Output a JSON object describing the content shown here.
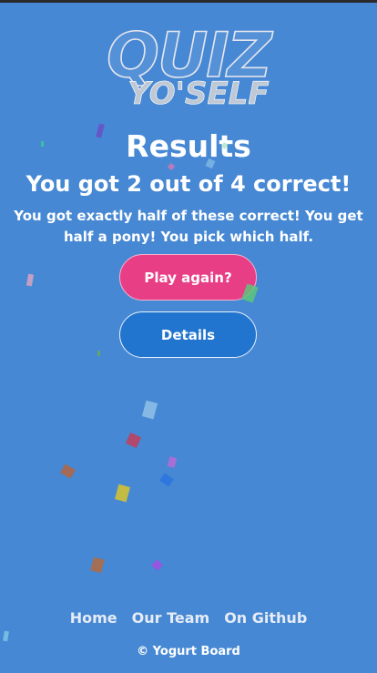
{
  "header": {
    "logo_line1": "QUIZ",
    "logo_line2": "YO'SELF"
  },
  "results": {
    "title": "Results",
    "score_text": "You got 2 out of 4 correct!",
    "message": "You got exactly half of these correct! You get half a pony! You pick which half."
  },
  "actions": {
    "play_again_label": "Play again?",
    "details_label": "Details"
  },
  "footer": {
    "links": [
      "Home",
      "Our Team",
      "On Github"
    ],
    "copyright": "© Yogurt Board"
  },
  "colors": {
    "background": "#4688d3",
    "play_button": "#e83e86",
    "details_button": "#2275cf"
  },
  "confetti_colors": [
    "#6b4fc8",
    "#3fc79a",
    "#c67ab8",
    "#d9a3c0",
    "#7eb6e6",
    "#b2e6c9",
    "#5cc77a",
    "#8fc1e8",
    "#c33e5a",
    "#b96bd6",
    "#b5653f",
    "#d9c62a",
    "#2b73e0",
    "#b36b3e",
    "#a24fe0",
    "#7ec6e6",
    "#6ca85a"
  ]
}
